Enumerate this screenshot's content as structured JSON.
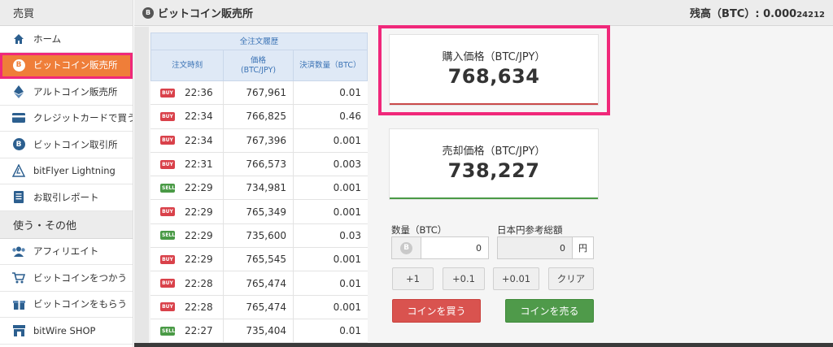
{
  "sidebar": {
    "section1": "売買",
    "items": [
      {
        "label": "ホーム",
        "icon": "home-icon"
      },
      {
        "label": "ビットコイン販売所",
        "icon": "bitcoin-icon",
        "active": true
      },
      {
        "label": "アルトコイン販売所",
        "icon": "ethereum-icon"
      },
      {
        "label": "クレジットカードで買う",
        "icon": "credit-card-icon"
      },
      {
        "label": "ビットコイン取引所",
        "icon": "bitcoin-icon"
      },
      {
        "label": "bitFlyer Lightning",
        "icon": "lightning-icon"
      },
      {
        "label": "お取引レポート",
        "icon": "report-icon"
      }
    ],
    "section2": "使う・その他",
    "items2": [
      {
        "label": "アフィリエイト",
        "icon": "users-icon"
      },
      {
        "label": "ビットコインをつかう",
        "icon": "cart-icon"
      },
      {
        "label": "ビットコインをもらう",
        "icon": "gift-icon"
      },
      {
        "label": "bitWire SHOP",
        "icon": "shop-icon"
      }
    ]
  },
  "header": {
    "icon_glyph": "B",
    "title": "ビットコイン販売所",
    "balance_label": "残高（BTC）: ",
    "balance_main": "0.000",
    "balance_small": "24212"
  },
  "history": {
    "title": "全注文履歴",
    "col_time": "注文時刻",
    "col_price": "価格\n(BTC/JPY)",
    "col_amount": "決済数量（BTC）",
    "rows": [
      {
        "side": "BUY",
        "time": "22:36",
        "price": "767,961",
        "amount": "0.01"
      },
      {
        "side": "BUY",
        "time": "22:34",
        "price": "766,825",
        "amount": "0.46"
      },
      {
        "side": "BUY",
        "time": "22:34",
        "price": "767,396",
        "amount": "0.001"
      },
      {
        "side": "BUY",
        "time": "22:31",
        "price": "766,573",
        "amount": "0.003"
      },
      {
        "side": "SELL",
        "time": "22:29",
        "price": "734,981",
        "amount": "0.001"
      },
      {
        "side": "BUY",
        "time": "22:29",
        "price": "765,349",
        "amount": "0.001"
      },
      {
        "side": "SELL",
        "time": "22:29",
        "price": "735,600",
        "amount": "0.03"
      },
      {
        "side": "BUY",
        "time": "22:29",
        "price": "765,545",
        "amount": "0.001"
      },
      {
        "side": "BUY",
        "time": "22:28",
        "price": "765,474",
        "amount": "0.01"
      },
      {
        "side": "BUY",
        "time": "22:28",
        "price": "765,474",
        "amount": "0.001"
      },
      {
        "side": "SELL",
        "time": "22:27",
        "price": "735,404",
        "amount": "0.01"
      }
    ]
  },
  "buy_card": {
    "label": "購入価格（BTC/JPY）",
    "price": "768,634"
  },
  "sell_card": {
    "label": "売却価格（BTC/JPY）",
    "price": "738,227"
  },
  "form": {
    "qty_label": "数量（BTC）",
    "qty_value": "0",
    "jpy_label": "日本円参考総額",
    "jpy_value": "0",
    "jpy_unit": "円",
    "steps": [
      "+1",
      "+0.1",
      "+0.01",
      "クリア"
    ],
    "buy_button": "コインを買う",
    "sell_button": "コインを売る"
  },
  "colors": {
    "accent_orange": "#ef7e39",
    "highlight_pink": "#f0287a",
    "buy_red": "#d9534f",
    "sell_green": "#4f9a4a"
  }
}
